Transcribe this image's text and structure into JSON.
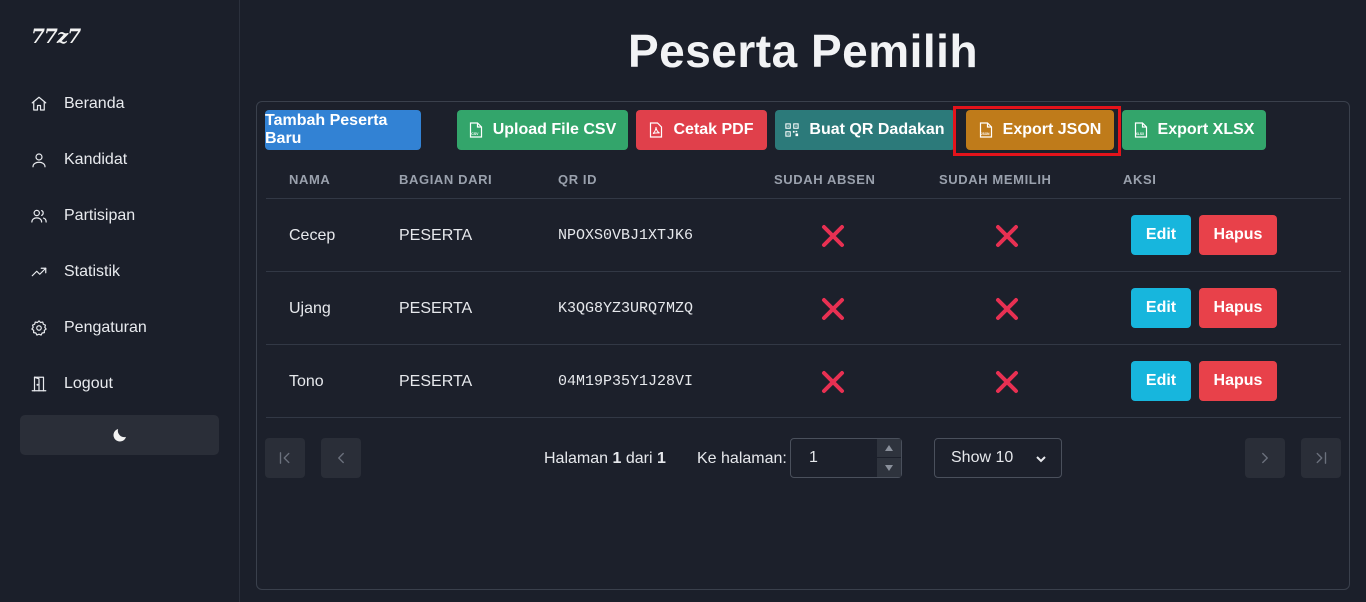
{
  "sidebar": {
    "logo": "77z7",
    "items": [
      {
        "label": "Beranda",
        "icon": "home-icon"
      },
      {
        "label": "Kandidat",
        "icon": "user-icon"
      },
      {
        "label": "Partisipan",
        "icon": "users-icon"
      },
      {
        "label": "Statistik",
        "icon": "trending-up-icon"
      },
      {
        "label": "Pengaturan",
        "icon": "gear-icon"
      },
      {
        "label": "Logout",
        "icon": "door-icon"
      }
    ],
    "theme_toggle_icon": "moon-icon"
  },
  "page": {
    "title": "Peserta Pemilih"
  },
  "toolbar": {
    "add_label": "Tambah Peserta Baru",
    "upload_label": "Upload File CSV",
    "pdf_label": "Cetak PDF",
    "qr_label": "Buat QR Dadakan",
    "json_label": "Export JSON",
    "xlsx_label": "Export XLSX",
    "colors": {
      "add": "#3282d4",
      "upload": "#33a56b",
      "pdf": "#e0404b",
      "qr": "#2c7a7a",
      "json": "#bf7b1a",
      "xlsx": "#33a56b"
    }
  },
  "table": {
    "headers": [
      "NAMA",
      "BAGIAN DARI",
      "QR ID",
      "SUDAH ABSEN",
      "SUDAH MEMILIH",
      "AKSI"
    ],
    "rows": [
      {
        "nama": "Cecep",
        "bagian": "PESERTA",
        "qr_id": "NPOXS0VBJ1XTJK6",
        "sudah_absen": false,
        "sudah_memilih": false
      },
      {
        "nama": "Ujang",
        "bagian": "PESERTA",
        "qr_id": "K3QG8YZ3URQ7MZQ",
        "sudah_absen": false,
        "sudah_memilih": false
      },
      {
        "nama": "Tono",
        "bagian": "PESERTA",
        "qr_id": "04M19P35Y1J28VI",
        "sudah_absen": false,
        "sudah_memilih": false
      }
    ],
    "edit_label": "Edit",
    "delete_label": "Hapus"
  },
  "pagination": {
    "page_prefix": "Halaman",
    "current_page": "1",
    "of_label": "dari",
    "total_pages": "1",
    "goto_label": "Ke halaman:",
    "goto_value": "1",
    "show_label": "Show 10"
  }
}
